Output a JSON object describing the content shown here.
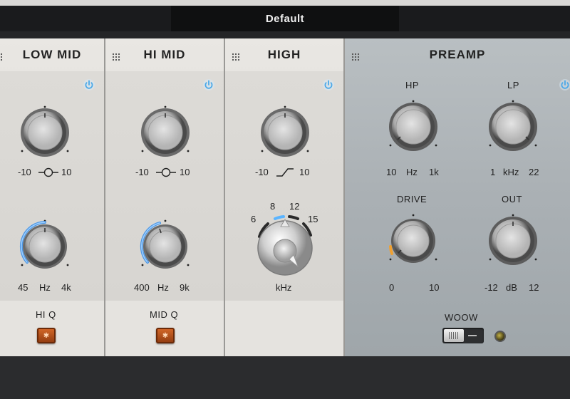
{
  "header": {
    "preset_name": "Default"
  },
  "panels": [
    {
      "id": "low-mid",
      "title": "LOW MID",
      "gain": {
        "min": "-10",
        "max": "10",
        "shape_icon": "bell-curve-icon"
      },
      "freq": {
        "min": "45",
        "unit": "Hz",
        "max": "4k",
        "ring_fraction": 0.45
      },
      "bottom_label": "HI Q"
    },
    {
      "id": "hi-mid",
      "title": "HI MID",
      "gain": {
        "min": "-10",
        "max": "10",
        "shape_icon": "bell-curve-icon"
      },
      "freq": {
        "min": "400",
        "unit": "Hz",
        "max": "9k",
        "ring_fraction": 0.35
      },
      "bottom_label": "MID Q"
    },
    {
      "id": "high",
      "title": "HIGH",
      "gain": {
        "min": "-10",
        "max": "10",
        "shape_icon": "shelf-curve-icon"
      },
      "selector": {
        "positions": [
          "6",
          "8",
          "12",
          "15"
        ],
        "selected": "8",
        "unit": "kHz"
      }
    }
  ],
  "preamp": {
    "title": "PREAMP",
    "hp": {
      "label": "HP",
      "min": "10",
      "unit": "Hz",
      "max": "1k"
    },
    "lp": {
      "label": "LP",
      "min": "1",
      "unit": "kHz",
      "max": "22"
    },
    "drive": {
      "label": "DRIVE",
      "min": "0",
      "max": "10"
    },
    "out": {
      "label": "OUT",
      "min": "-12",
      "unit": "dB",
      "max": "12"
    },
    "woow": {
      "label": "WOOW"
    }
  },
  "colors": {
    "power_blue": "#4aa8e8",
    "ring_blue": "#3d8fe6",
    "drive_orange": "#f0a030",
    "q_button": "#c95a20"
  }
}
